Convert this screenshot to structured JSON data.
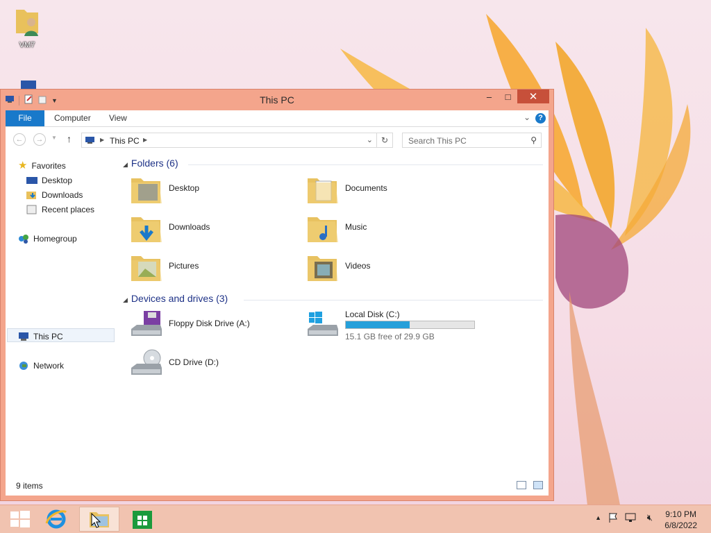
{
  "desktop": {
    "icons": [
      {
        "label": "VM7"
      }
    ]
  },
  "window": {
    "title": "This PC",
    "controls": {
      "minimize": "–",
      "maximize": "□",
      "close": "✕"
    },
    "ribbon": {
      "tabs": [
        "File",
        "Computer",
        "View"
      ],
      "help": "?"
    },
    "address": {
      "crumb": "This PC"
    },
    "search": {
      "placeholder": "Search This PC"
    },
    "nav": {
      "favorites": "Favorites",
      "desktop": "Desktop",
      "downloads": "Downloads",
      "recent": "Recent places",
      "homegroup": "Homegroup",
      "thispc": "This PC",
      "network": "Network"
    },
    "folders_header": "Folders (6)",
    "folders": [
      "Desktop",
      "Documents",
      "Downloads",
      "Music",
      "Pictures",
      "Videos"
    ],
    "devices_header": "Devices and drives (3)",
    "drives": {
      "floppy": "Floppy Disk Drive (A:)",
      "local": "Local Disk (C:)",
      "local_free": "15.1 GB free of 29.9 GB",
      "local_used_fraction": 0.495,
      "cd": "CD Drive (D:)"
    },
    "status": "9 items"
  },
  "taskbar": {
    "time": "9:10 PM",
    "date": "6/8/2022"
  },
  "colors": {
    "accent": "#1979ca",
    "titlebar": "#f4a58c",
    "close": "#c7503a",
    "drive_bar": "#26a0da"
  }
}
